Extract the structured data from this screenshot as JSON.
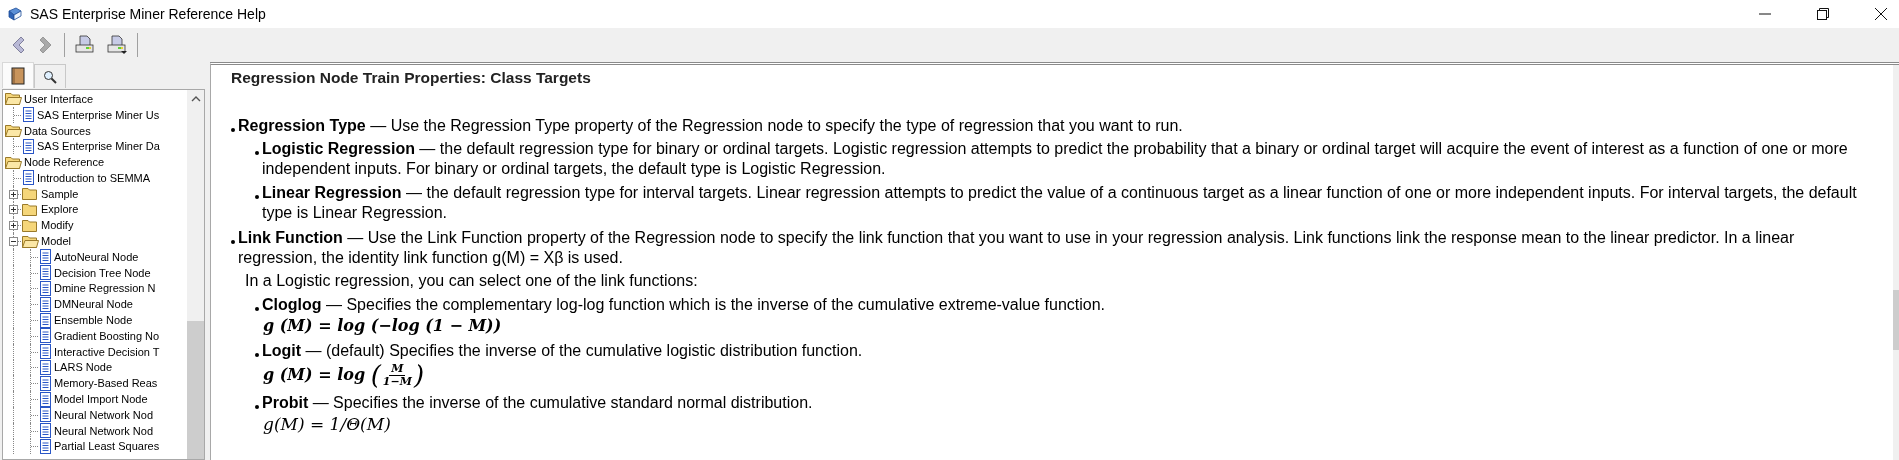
{
  "window": {
    "title": "SAS Enterprise Miner Reference Help"
  },
  "toolbar": [
    {
      "kind": "back",
      "disabled": false
    },
    {
      "kind": "forward",
      "disabled": true
    },
    {
      "kind": "print",
      "disabled": false
    },
    {
      "kind": "print-setup",
      "disabled": false
    }
  ],
  "nav_tabs": [
    {
      "kind": "contents",
      "selected": true
    },
    {
      "kind": "search",
      "selected": false
    }
  ],
  "tree": {
    "items": [
      {
        "kind": "folder",
        "label": "User Interface",
        "expanded": true,
        "children": [
          {
            "kind": "page",
            "label": "SAS Enterprise Miner Us"
          }
        ]
      },
      {
        "kind": "folder",
        "label": "Data Sources",
        "expanded": true,
        "children": [
          {
            "kind": "page",
            "label": "SAS Enterprise Miner Da"
          }
        ]
      },
      {
        "kind": "folder",
        "label": "Node Reference",
        "expanded": true,
        "children": [
          {
            "kind": "page",
            "label": "Introduction to SEMMA"
          },
          {
            "kind": "folder",
            "label": "Sample",
            "expanded": false
          },
          {
            "kind": "folder",
            "label": "Explore",
            "expanded": false
          },
          {
            "kind": "folder",
            "label": "Modify",
            "expanded": false
          },
          {
            "kind": "folder",
            "label": "Model",
            "expanded": true,
            "children": [
              {
                "kind": "page",
                "label": "AutoNeural Node"
              },
              {
                "kind": "page",
                "label": "Decision Tree Node"
              },
              {
                "kind": "page",
                "label": "Dmine Regression N"
              },
              {
                "kind": "page",
                "label": "DMNeural Node"
              },
              {
                "kind": "page",
                "label": "Ensemble Node"
              },
              {
                "kind": "page",
                "label": "Gradient Boosting No"
              },
              {
                "kind": "page",
                "label": "Interactive Decision T"
              },
              {
                "kind": "page",
                "label": "LARS Node"
              },
              {
                "kind": "page",
                "label": "Memory-Based Reas"
              },
              {
                "kind": "page",
                "label": "Model Import Node"
              },
              {
                "kind": "page",
                "label": "Neural Network Nod"
              },
              {
                "kind": "page",
                "label": "Neural Network Nod"
              },
              {
                "kind": "page",
                "label": "Partial Least Squares"
              }
            ]
          }
        ]
      }
    ]
  },
  "article": {
    "title": "Regression Node Train Properties: Class Targets",
    "items": [
      {
        "text": "**Regression Type** — Use the Regression Type property of the Regression node to specify the type of regression that you want to run.",
        "children": [
          {
            "text": "**Logistic Regression** — the default regression type for binary or ordinal targets. Logistic regression attempts to predict the probability that a binary or ordinal target will acquire the event of interest as a function of one or more independent inputs. For binary or ordinal targets, the default type is Logistic Regression."
          },
          {
            "text": "**Linear Regression** — the default regression type for interval targets. Linear regression attempts to predict the value of a continuous target as a linear function of one or more independent inputs. For interval targets, the default type is Linear Regression."
          }
        ]
      },
      {
        "text": "**Link Function** — Use the Link Function property of the Regression node to specify the link function that you want to use in your regression analysis. Link functions link the response mean to the linear predictor. In a linear regression, the identity link function g(M) = Xβ is used.",
        "note": "In a Logistic regression, you can select one of the link functions:",
        "children": [
          {
            "text": "**Cloglog** — Specifies the complementary log-log function which is the inverse of the cumulative extreme-value function.",
            "formula": {
              "kind": "inline",
              "bold": true,
              "text": "g (M) = log (−log (1 − M))"
            }
          },
          {
            "text": "**Logit** — (default) Specifies the inverse of the cumulative logistic distribution function.",
            "formula": {
              "kind": "fraction",
              "bold": true,
              "before": "g (M) = log",
              "open": "(",
              "numerator": "M",
              "denominator": "1−M",
              "close": ")"
            }
          },
          {
            "text": "**Probit** — Specifies the inverse of the cumulative standard normal distribution.",
            "formula": {
              "kind": "inline",
              "bold": false,
              "text": "g(M) = 1/Θ(M)"
            }
          }
        ]
      }
    ]
  }
}
